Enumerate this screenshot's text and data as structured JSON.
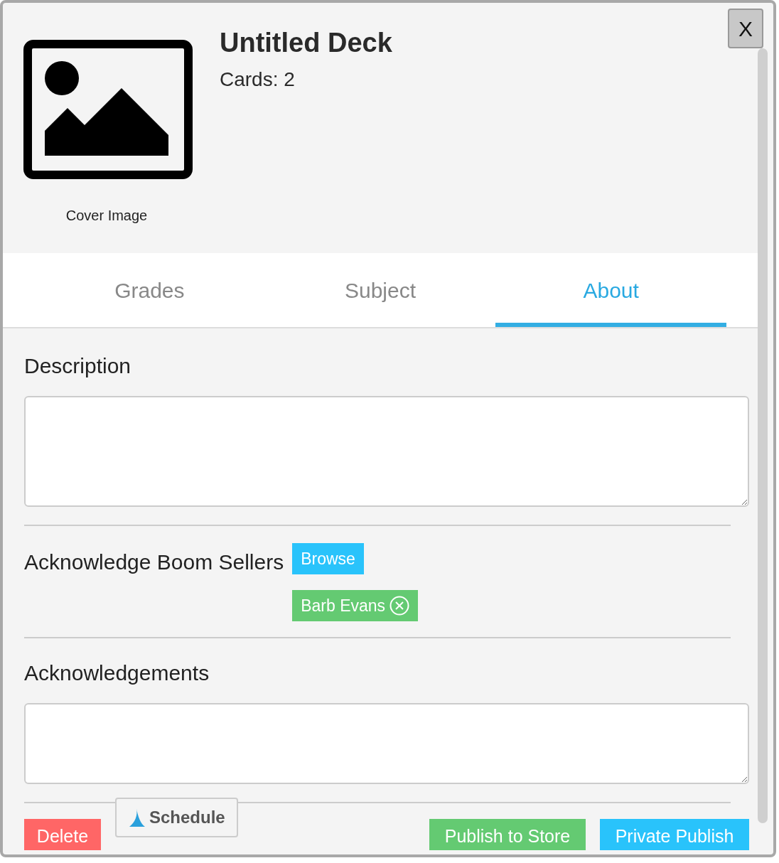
{
  "header": {
    "title": "Untitled Deck",
    "cards": "Cards: 2",
    "cover_caption": "Cover Image",
    "close": "X"
  },
  "tabs": [
    {
      "label": "Grades",
      "selected": false
    },
    {
      "label": "Subject",
      "selected": false
    },
    {
      "label": "About",
      "selected": true
    }
  ],
  "description": {
    "label": "Description"
  },
  "sellers": {
    "label": "Acknowledge Boom Sellers",
    "browse": "Browse",
    "tags": [
      "Barb Evans"
    ]
  },
  "acknowledgements": {
    "label": "Acknowledgements"
  },
  "footer": {
    "delete": "Delete",
    "schedule": "Schedule",
    "publish": "Publish to Store",
    "private": "Private Publish"
  }
}
